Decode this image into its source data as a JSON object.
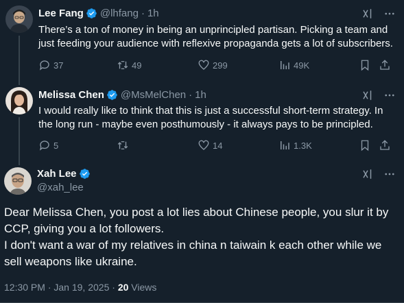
{
  "tweets": [
    {
      "name": "Lee Fang",
      "handle": "@lhfang",
      "time": "1h",
      "text": "There’s a ton of money in being an unprincipled partisan. Picking a team and just feeding your audience with reflexive propaganda gets a lot of subscribers.",
      "replies": "37",
      "retweets": "49",
      "likes": "299",
      "views": "49K"
    },
    {
      "name": "Melissa Chen",
      "handle": "@MsMelChen",
      "time": "1h",
      "text": "I would really like to think that this is just a successful short-term strategy. In the long run - maybe even posthumously - it always pays to be principled.",
      "replies": "5",
      "retweets": "",
      "likes": "14",
      "views": "1.3K"
    }
  ],
  "main_tweet": {
    "name": "Xah Lee",
    "handle": "@xah_lee",
    "text_lines": [
      "Dear Melissa Chen, you post a lot lies about Chinese people, you slur it by",
      "CCP, giving you a lot followers.",
      "I don't want a war of my relatives in china n taiwain k each other while we",
      "sell weapons like ukraine."
    ],
    "time": "12:30 PM",
    "date": "Jan 19, 2025",
    "views_count": "20",
    "views_label": "Views"
  },
  "colors": {
    "background": "#15202b",
    "text": "#f7f9f9",
    "muted": "#8b98a5",
    "verified": "#1d9bf0"
  },
  "icons": [
    "verified-badge-icon",
    "grok-icon",
    "more-icon",
    "reply-icon",
    "retweet-icon",
    "like-icon",
    "views-icon",
    "bookmark-icon",
    "share-icon"
  ]
}
